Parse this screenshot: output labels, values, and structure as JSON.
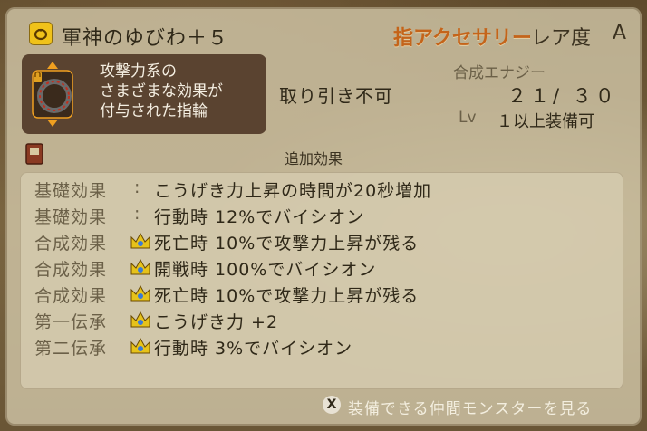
{
  "item": {
    "name": "軍神のゆびわ＋５",
    "category": "指アクセサリー",
    "rarity_label": "レア度",
    "rarity_value": "A",
    "description": "攻撃力系の\nさまざまな効果が\n付与された指輪",
    "trade_status": "取り引き不可",
    "energy_label": "合成エナジー",
    "energy_value": "２１/ ３０",
    "level_label": "Lv",
    "level_text": "１以上装備可"
  },
  "effects": {
    "title": "追加効果",
    "rows": [
      {
        "label": "基礎効果",
        "sep": ":",
        "icon": null,
        "text": "こうげき力上昇の時間が20秒増加"
      },
      {
        "label": "基礎効果",
        "sep": ":",
        "icon": null,
        "text": "行動時 12%でバイシオン"
      },
      {
        "label": "合成効果",
        "sep": null,
        "icon": "crown-icon",
        "text": "死亡時 10%で攻撃力上昇が残る"
      },
      {
        "label": "合成効果",
        "sep": null,
        "icon": "crown-icon",
        "text": "開戦時 100%でバイシオン"
      },
      {
        "label": "合成効果",
        "sep": null,
        "icon": "crown-icon",
        "text": "死亡時 10%で攻撃力上昇が残る"
      },
      {
        "label": "第一伝承",
        "sep": null,
        "icon": "crown-icon",
        "text": "こうげき力 +2"
      },
      {
        "label": "第二伝承",
        "sep": null,
        "icon": "crown-icon",
        "text": "行動時 3%でバイシオン"
      }
    ]
  },
  "footer": {
    "button_glyph": "X",
    "text": "装備できる仲間モンスターを見る"
  },
  "colors": {
    "category": "#c4641a",
    "panel": "#d0c4a6",
    "desc_box": "#5a4330",
    "badge": "#f0c21a"
  }
}
